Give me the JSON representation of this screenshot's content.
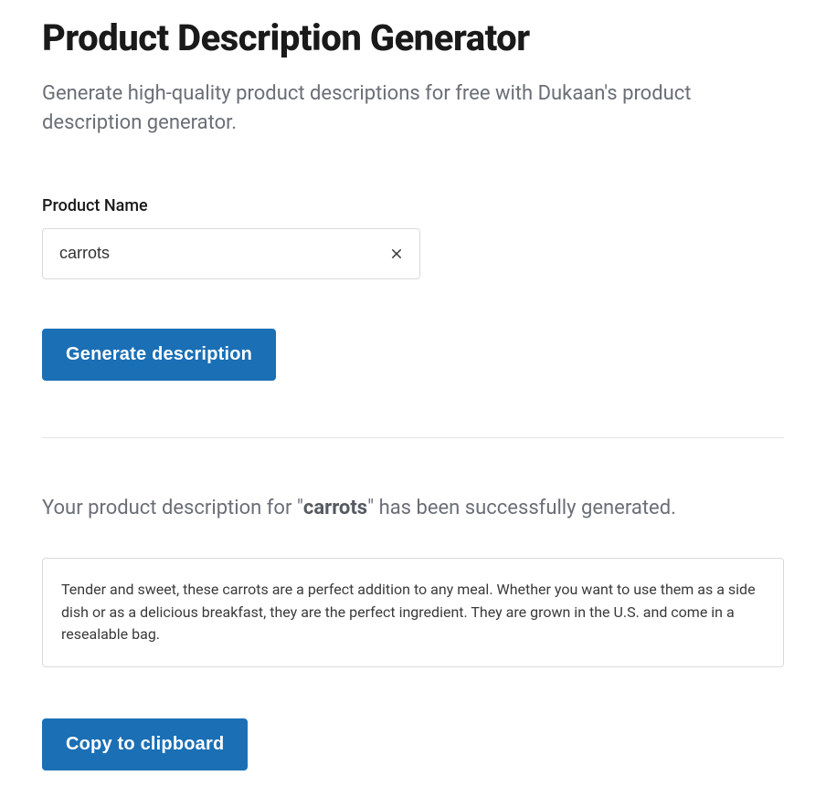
{
  "header": {
    "title": "Product Description Generator",
    "subtitle": "Generate high-quality product descriptions for free with Dukaan's product description generator."
  },
  "form": {
    "product_name_label": "Product Name",
    "product_name_value": "carrots",
    "generate_button_label": "Generate description"
  },
  "result": {
    "prefix": "Your product description for \"",
    "product": "carrots",
    "suffix": "\" has been successfully generated.",
    "description": "Tender and sweet, these carrots are a perfect addition to any meal. Whether you want to use them as a side dish or as a delicious breakfast, they are the perfect ingredient. They are grown in the U.S. and come in a resealable bag.",
    "copy_button_label": "Copy to clipboard"
  },
  "colors": {
    "primary": "#1a6fb5",
    "text": "#1a1a1a",
    "muted": "#6b6e76",
    "border": "#d9d9d9"
  }
}
